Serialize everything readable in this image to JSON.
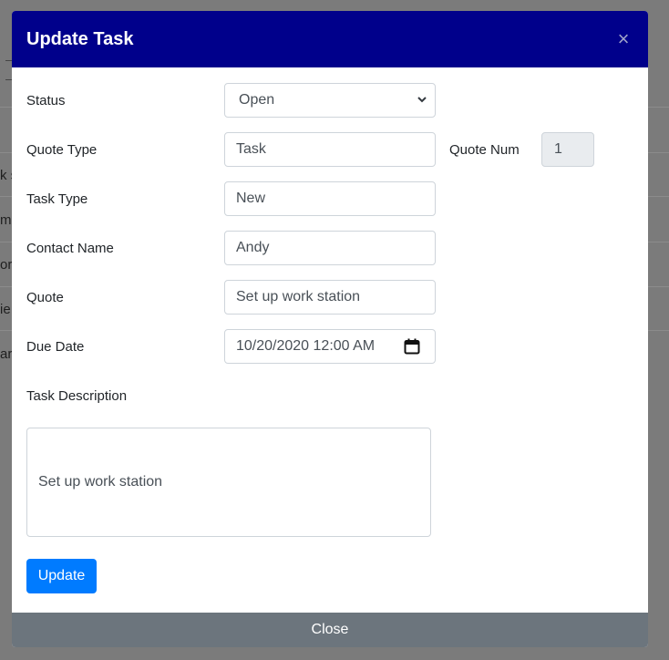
{
  "background": {
    "fragments": [
      "k s",
      "m",
      "or",
      "ie",
      "ar"
    ]
  },
  "modal": {
    "title": "Update Task",
    "close_symbol": "×",
    "fields": {
      "status": {
        "label": "Status",
        "value": "Open"
      },
      "quote_type": {
        "label": "Quote Type",
        "value": "Task"
      },
      "quote_num": {
        "label": "Quote Num",
        "value": "1"
      },
      "task_type": {
        "label": "Task Type",
        "value": "New"
      },
      "contact_name": {
        "label": "Contact Name",
        "value": "Andy"
      },
      "quote": {
        "label": "Quote",
        "value": "Set up work station"
      },
      "due_date": {
        "label": "Due Date",
        "value": "10/20/2020 12:00 AM"
      },
      "task_description": {
        "label": "Task Description",
        "value": "Set up work station"
      }
    },
    "update_label": "Update",
    "close_label": "Close"
  },
  "icons": {
    "select_arrow": "chevron-down-icon",
    "calendar": "calendar-icon",
    "close": "close-icon"
  },
  "colors": {
    "header": "#00008b",
    "primary_button": "#007bff",
    "footer": "#6c757d"
  }
}
